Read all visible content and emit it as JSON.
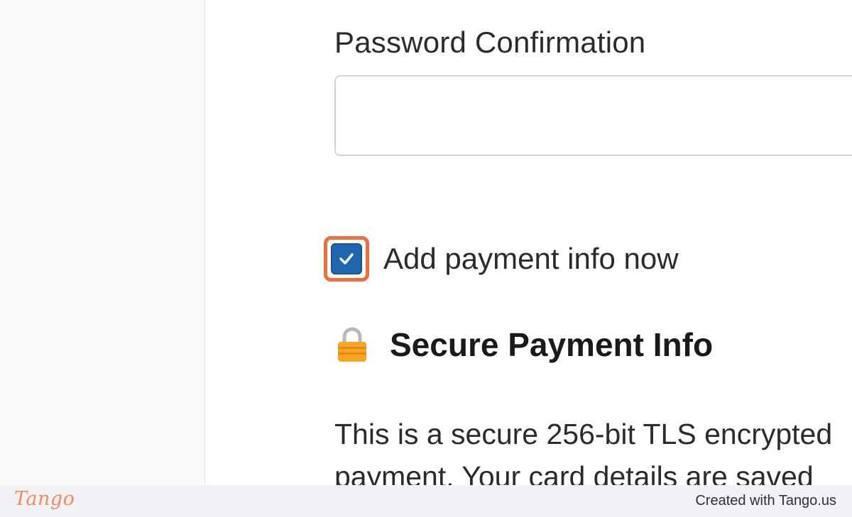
{
  "form": {
    "password_confirmation_label": "Password Confirmation",
    "password_confirmation_value": "",
    "add_payment_label": "Add payment info now",
    "add_payment_checked": true
  },
  "payment_section": {
    "heading": "Secure Payment Info",
    "lock_icon": "lock-icon",
    "description": "This is a secure 256-bit TLS encrypted payment. Your card details are saved securely with us"
  },
  "footer": {
    "logo_text": "Tango",
    "credit": "Created with Tango.us"
  },
  "colors": {
    "accent_highlight": "#f06e3c",
    "checkbox_fill": "#1f66b0",
    "lock_body": "#f5a623",
    "footer_bg": "#f2f1f6",
    "tango_brand": "#f08a5d"
  }
}
